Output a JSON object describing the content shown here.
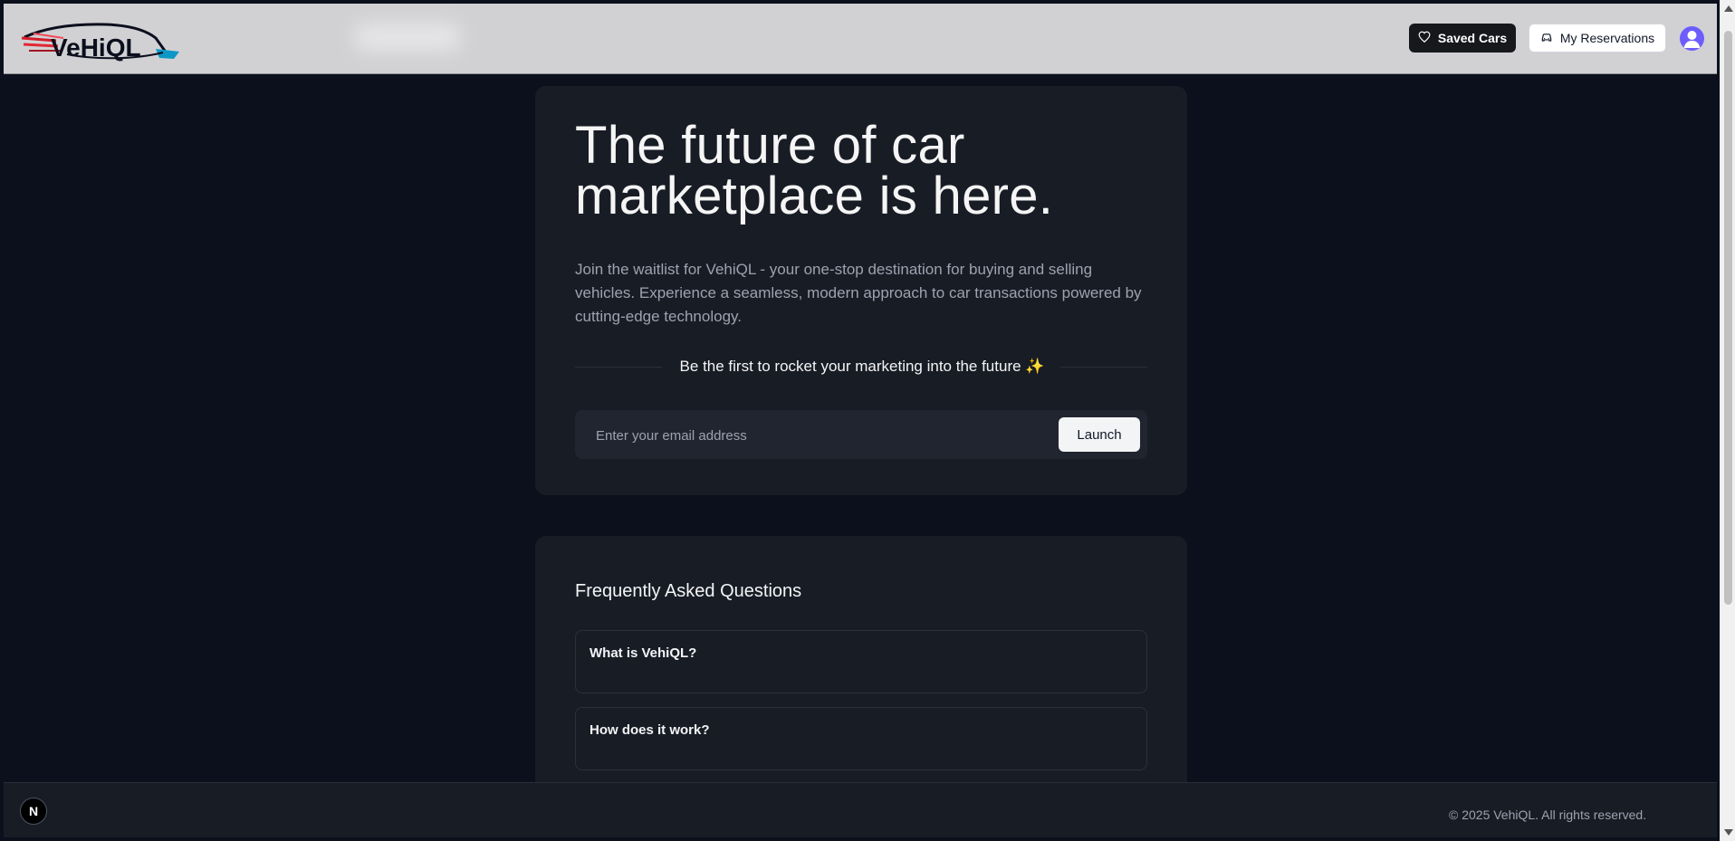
{
  "brand": {
    "name": "VehiQL"
  },
  "header": {
    "saved_cars_label": "Saved Cars",
    "my_reservations_label": "My Reservations"
  },
  "hero": {
    "title_line1": "The future of car",
    "title_line2": "marketplace is here.",
    "description": "Join the waitlist for VehiQL - your one-stop destination for buying and selling vehicles. Experience a seamless, modern approach to car transactions powered by cutting-edge technology.",
    "divider_text": "Be the first to rocket your marketing into the future ✨",
    "email_placeholder": "Enter your email address",
    "launch_label": "Launch"
  },
  "faq": {
    "title": "Frequently Asked Questions",
    "items": [
      {
        "question": "What is VehiQL?"
      },
      {
        "question": "How does it work?"
      }
    ]
  },
  "footer": {
    "copyright": "© 2025 VehiQL. All rights reserved.",
    "badge": "N"
  },
  "colors": {
    "background": "#0b101c",
    "card": "#181c25",
    "header": "#d1d1d4",
    "accent": "#6d5dfc"
  }
}
